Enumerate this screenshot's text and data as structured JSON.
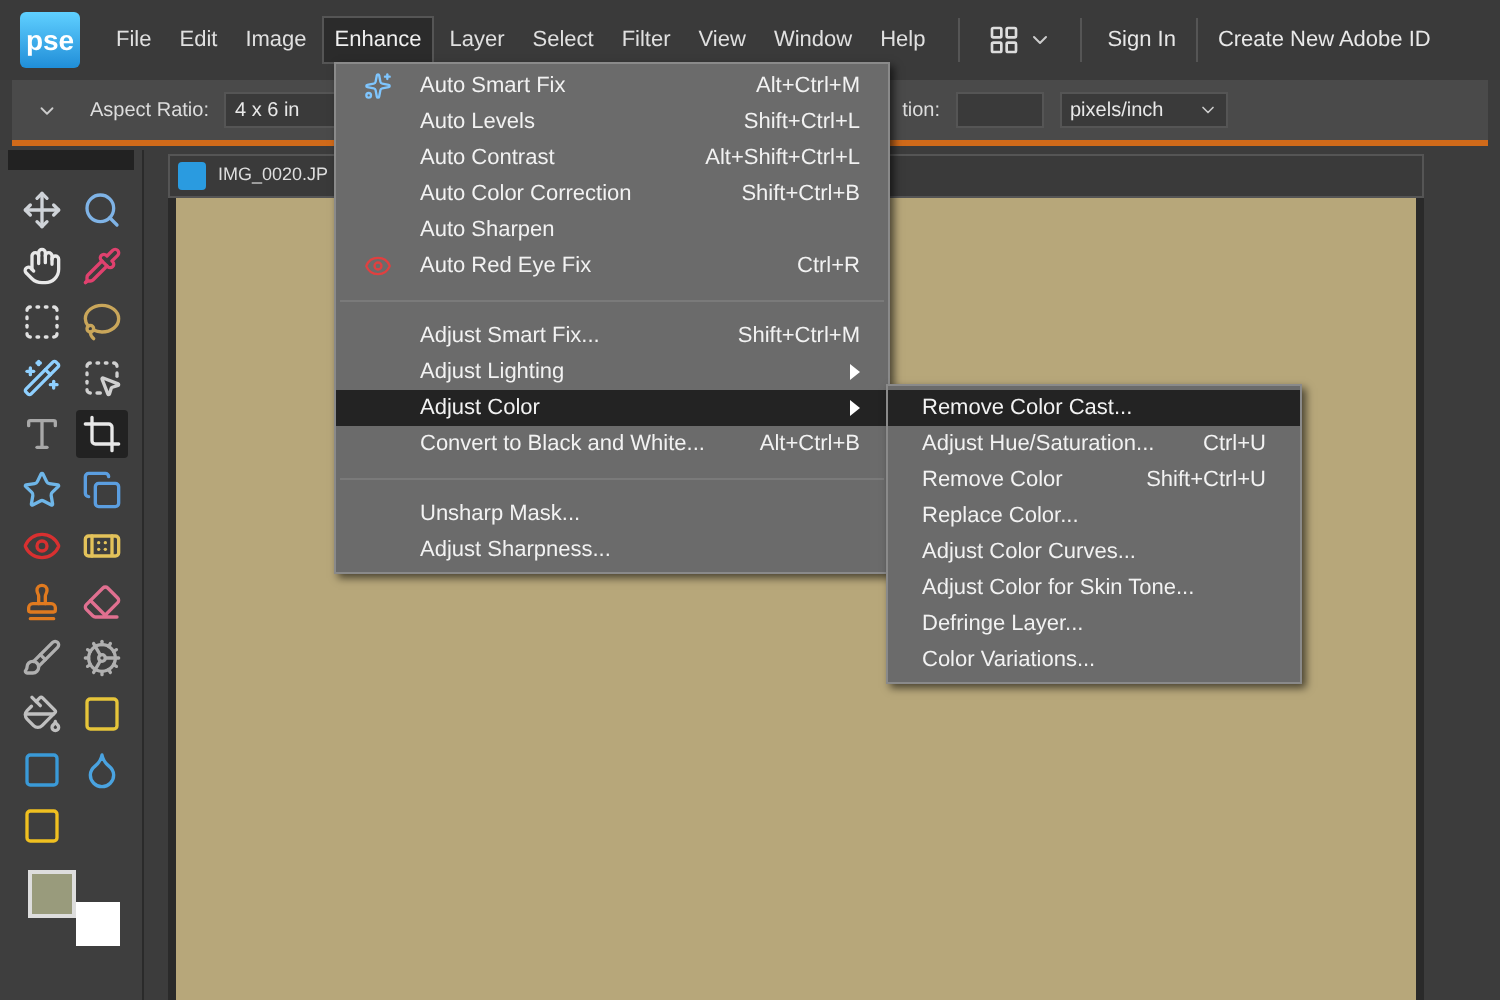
{
  "menu_bar": {
    "logo": "pse",
    "items": [
      {
        "label": "File",
        "selected": false
      },
      {
        "label": "Edit",
        "selected": false
      },
      {
        "label": "Image",
        "selected": false
      },
      {
        "label": "Enhance",
        "selected": true
      },
      {
        "label": "Layer",
        "selected": false
      },
      {
        "label": "Select",
        "selected": false
      },
      {
        "label": "Filter",
        "selected": false
      },
      {
        "label": "View",
        "selected": false
      },
      {
        "label": "Window",
        "selected": false
      },
      {
        "label": "Help",
        "selected": false
      }
    ],
    "sign_in": "Sign In",
    "create_id": "Create New Adobe ID"
  },
  "options_bar": {
    "aspect_ratio_label": "Aspect Ratio:",
    "aspect_ratio_value": "4 x 6 in",
    "resolution_label": "tion:",
    "units": "pixels/inch"
  },
  "toolbox": {
    "tools": [
      {
        "selected": false
      },
      {
        "selected": false
      },
      {
        "selected": false
      },
      {
        "selected": false
      },
      {
        "selected": false
      },
      {
        "selected": false
      },
      {
        "selected": false
      },
      {
        "selected": false
      },
      {
        "selected": false
      },
      {
        "selected": true
      },
      {
        "selected": false
      },
      {
        "selected": false
      },
      {
        "selected": false
      },
      {
        "selected": false
      },
      {
        "selected": false
      },
      {
        "selected": false
      },
      {
        "selected": false
      },
      {
        "selected": false
      },
      {
        "selected": false
      },
      {
        "selected": false
      },
      {
        "selected": false
      },
      {
        "selected": false
      },
      {
        "selected": false
      }
    ]
  },
  "document": {
    "title": "IMG_0020.JP"
  },
  "enhance_menu": {
    "sections": [
      [
        {
          "label": "Auto Smart Fix",
          "shortcut": "Alt+Ctrl+M",
          "kind": "smart-fix",
          "submenu": false,
          "selected": false
        },
        {
          "label": "Auto Levels",
          "shortcut": "Shift+Ctrl+L",
          "kind": "plain",
          "submenu": false,
          "selected": false
        },
        {
          "label": "Auto Contrast",
          "shortcut": "Alt+Shift+Ctrl+L",
          "kind": "plain",
          "submenu": false,
          "selected": false
        },
        {
          "label": "Auto Color Correction",
          "shortcut": "Shift+Ctrl+B",
          "kind": "plain",
          "submenu": false,
          "selected": false
        },
        {
          "label": "Auto Sharpen",
          "kind": "plain",
          "submenu": false,
          "selected": false
        },
        {
          "label": "Auto Red Eye Fix",
          "shortcut": "Ctrl+R",
          "kind": "red-eye",
          "submenu": false,
          "selected": false
        }
      ],
      [
        {
          "label": "Adjust Smart Fix...",
          "shortcut": "Shift+Ctrl+M",
          "kind": "plain",
          "submenu": false,
          "selected": false
        },
        {
          "label": "Adjust Lighting",
          "kind": "plain",
          "submenu": true,
          "selected": false
        },
        {
          "label": "Adjust Color",
          "kind": "plain",
          "submenu": true,
          "selected": true
        },
        {
          "label": "Convert to Black and White...",
          "shortcut": "Alt+Ctrl+B",
          "kind": "plain",
          "submenu": false,
          "selected": false
        }
      ],
      [
        {
          "label": "Unsharp Mask...",
          "kind": "plain",
          "submenu": false,
          "selected": false
        },
        {
          "label": "Adjust Sharpness...",
          "kind": "plain",
          "submenu": false,
          "selected": false
        }
      ]
    ]
  },
  "adjust_color_submenu": {
    "items": [
      {
        "label": "Remove Color Cast...",
        "selected": true
      },
      {
        "label": "Adjust Hue/Saturation...",
        "shortcut": "Ctrl+U",
        "selected": false
      },
      {
        "label": "Remove Color",
        "shortcut": "Shift+Ctrl+U",
        "selected": false
      },
      {
        "label": "Replace Color...",
        "selected": false
      },
      {
        "label": "Adjust Color Curves...",
        "selected": false
      },
      {
        "label": "Adjust Color for Skin Tone...",
        "selected": false
      },
      {
        "label": "Defringe Layer...",
        "selected": false
      },
      {
        "label": "Color Variations...",
        "selected": false
      }
    ]
  }
}
